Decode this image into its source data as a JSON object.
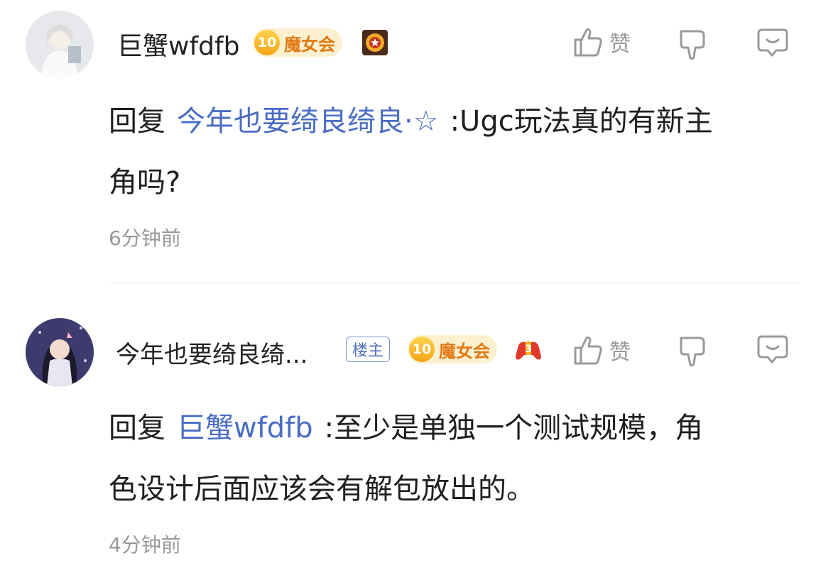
{
  "comments": [
    {
      "username": "巨蟹wfdfb",
      "level": "10",
      "level_name": "魔女会",
      "like_label": "赞",
      "reply_word": "回复",
      "reply_target": "今年也要绮良绮良·☆",
      "text_line1": ":Ugc玩法真的有新主",
      "text_line2": "角吗?",
      "time": "6分钟前",
      "medal_icon": "gear-star-medal-icon"
    },
    {
      "username": "今年也要绮良绮...",
      "owner_tag": "楼主",
      "level": "10",
      "level_name": "魔女会",
      "like_label": "赞",
      "reply_word": "回复",
      "reply_target": "巨蟹wfdfb",
      "text_line1": ":至少是单独一个测试规模，角",
      "text_line2": "色设计后面应该会有解包放出的。",
      "time": "4分钟前",
      "medal_icon": "gamepad-medal-icon"
    }
  ],
  "colors": {
    "link": "#4a6cc4",
    "muted": "#999999",
    "badge_bg": "#fdf0cf",
    "badge_text": "#e07a16"
  }
}
